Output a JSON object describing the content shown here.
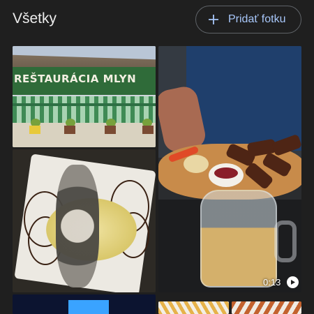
{
  "header": {
    "title": "Všetky",
    "add_button_label": "Pridať fotku"
  },
  "photos": [
    {
      "sign_text": "REŠTAURÁCIA MLYN"
    },
    {},
    {},
    {
      "duration": "0:13"
    },
    {},
    {}
  ],
  "colors": {
    "background": "#1f1f1f",
    "accent": "#a8c7fa"
  },
  "icons": [
    "plus-icon",
    "play-icon"
  ]
}
